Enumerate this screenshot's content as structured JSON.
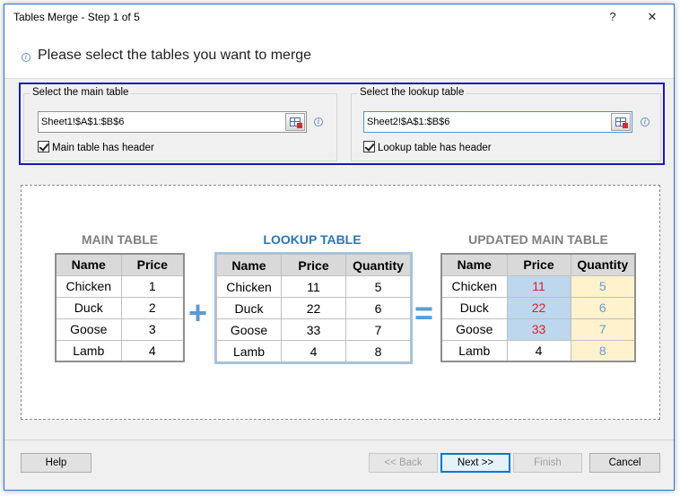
{
  "window": {
    "title": "Tables Merge - Step 1 of 5",
    "help_glyph": "?",
    "close_glyph": "✕"
  },
  "header": {
    "heading": "Please select the tables you want to merge"
  },
  "main_group": {
    "legend": "Select the main table",
    "range_value": "Sheet1!$A$1:$B$6",
    "checkbox_label": "Main table has header",
    "checked": true
  },
  "lookup_group": {
    "legend": "Select the lookup table",
    "range_value": "Sheet2!$A$1:$B$6",
    "checkbox_label": "Lookup table has header",
    "checked": true
  },
  "preview": {
    "main": {
      "caption": "MAIN TABLE",
      "headers": [
        "Name",
        "Price"
      ],
      "rows": [
        [
          "Chicken",
          "1"
        ],
        [
          "Duck",
          "2"
        ],
        [
          "Goose",
          "3"
        ],
        [
          "Lamb",
          "4"
        ]
      ]
    },
    "lookup": {
      "caption": "LOOKUP TABLE",
      "headers": [
        "Name",
        "Price",
        "Quantity"
      ],
      "rows": [
        [
          "Chicken",
          "11",
          "5"
        ],
        [
          "Duck",
          "22",
          "6"
        ],
        [
          "Goose",
          "33",
          "7"
        ],
        [
          "Lamb",
          "4",
          "8"
        ]
      ]
    },
    "updated": {
      "caption": "UPDATED MAIN TABLE",
      "headers": [
        "Name",
        "Price",
        "Quantity"
      ],
      "rows": [
        [
          "Chicken",
          "11",
          "5"
        ],
        [
          "Duck",
          "22",
          "6"
        ],
        [
          "Goose",
          "33",
          "7"
        ],
        [
          "Lamb",
          "4",
          "8"
        ]
      ]
    },
    "plus": "+",
    "equals": "=",
    "colors": {
      "caption_gray": "#7f7f7f",
      "caption_blue": "#2e75b6",
      "header_bg": "#d9d9d9",
      "price_highlight_bg": "#bdd7ee",
      "quantity_highlight_bg": "#fff2cc",
      "updated_price_text": "#e02020",
      "updated_quantity_text": "#6a9bd8",
      "operator": "#5b9bd5"
    }
  },
  "buttons": {
    "help": "Help",
    "back": "<< Back",
    "next": "Next >>",
    "finish": "Finish",
    "cancel": "Cancel"
  },
  "icons": {
    "info": "info-icon",
    "range_select": "range-select-icon",
    "help": "question-mark-icon",
    "close": "close-icon"
  }
}
